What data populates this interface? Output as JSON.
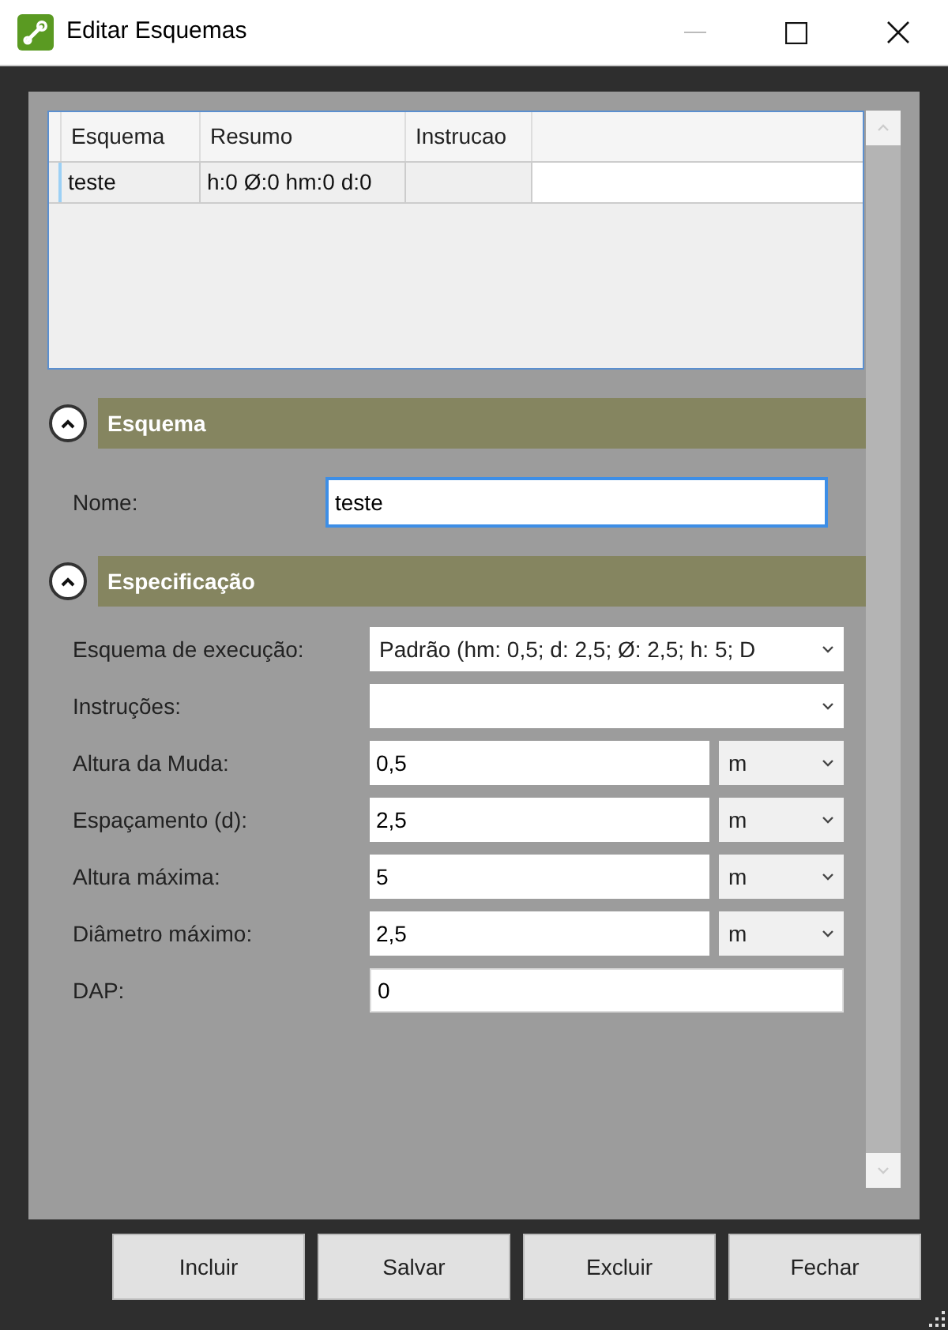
{
  "window": {
    "title": "Editar Esquemas"
  },
  "table": {
    "columns": [
      "Esquema",
      "Resumo",
      "Instrucao"
    ],
    "rows": [
      {
        "cells": [
          "teste",
          "h:0 Ø:0 hm:0 d:0",
          ""
        ]
      }
    ]
  },
  "sections": [
    {
      "title": "Esquema",
      "expanded": true,
      "fields": [
        {
          "kind": "text",
          "label": "Nome:",
          "value": "teste",
          "focused": true
        }
      ]
    },
    {
      "title": "Especificação",
      "expanded": true,
      "fields": [
        {
          "kind": "select",
          "label": "Esquema de execução:",
          "value": "Padrão (hm: 0,5; d: 2,5; Ø: 2,5; h: 5; D"
        },
        {
          "kind": "select",
          "label": "Instruções:"
        },
        {
          "kind": "unit",
          "label": "Altura da Muda:",
          "value": "0,5",
          "unit": "m"
        },
        {
          "kind": "unit",
          "label": "Espaçamento (d):",
          "value": "2,5",
          "unit": "m"
        },
        {
          "kind": "unit",
          "label": "Altura máxima:",
          "value": "5",
          "unit": "m"
        },
        {
          "kind": "unit",
          "label": "Diâmetro máximo:",
          "value": "2,5",
          "unit": "m"
        },
        {
          "kind": "text",
          "label": "DAP:",
          "value": "0",
          "focused": false
        }
      ]
    }
  ],
  "buttons": [
    "Incluir",
    "Salvar",
    "Excluir",
    "Fechar"
  ]
}
